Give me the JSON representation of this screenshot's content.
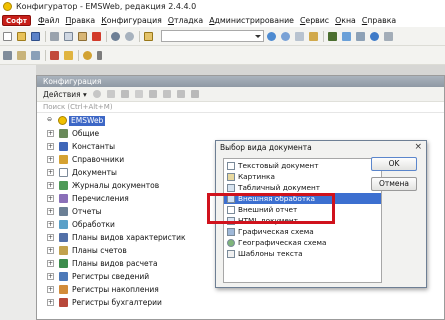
{
  "window": {
    "title": "Конфигуратор - EMSWeb, редакция 2.4.4.0"
  },
  "menubar": {
    "logo": "Софт",
    "items": [
      "Файл",
      "Правка",
      "Конфигурация",
      "Отладка",
      "Администрирование",
      "Сервис",
      "Окна",
      "Справка"
    ]
  },
  "config_window": {
    "title": "Конфигурация",
    "actions_label": "Действия ▾",
    "search_placeholder": "Поиск (Ctrl+Alt+M)",
    "root": "EMSWeb",
    "nodes": [
      {
        "label": "Общие",
        "icon": "common-icon"
      },
      {
        "label": "Константы",
        "icon": "constants-icon"
      },
      {
        "label": "Справочники",
        "icon": "catalogs-icon"
      },
      {
        "label": "Документы",
        "icon": "documents-icon"
      },
      {
        "label": "Журналы документов",
        "icon": "journals-icon"
      },
      {
        "label": "Перечисления",
        "icon": "enums-icon"
      },
      {
        "label": "Отчеты",
        "icon": "reports-icon"
      },
      {
        "label": "Обработки",
        "icon": "processing-icon"
      },
      {
        "label": "Планы видов характеристик",
        "icon": "chart-types-icon"
      },
      {
        "label": "Планы счетов",
        "icon": "chart-accounts-icon"
      },
      {
        "label": "Планы видов расчета",
        "icon": "calc-types-icon"
      },
      {
        "label": "Регистры сведений",
        "icon": "info-registers-icon"
      },
      {
        "label": "Регистры накопления",
        "icon": "accum-registers-icon"
      },
      {
        "label": "Регистры бухгалтерии",
        "icon": "account-registers-icon"
      }
    ]
  },
  "dialog": {
    "title": "Выбор вида документа",
    "close": "×",
    "ok": "OK",
    "cancel": "Отмена",
    "items": [
      "Текстовый документ",
      "Картинка",
      "Табличный документ",
      "Внешняя обработка",
      "Внешний отчет",
      "HTML документ",
      "Графическая схема",
      "Географическая схема",
      "Шаблоны текста"
    ],
    "selected_index": 3
  },
  "colors": {
    "selection": "#3c6fd0",
    "highlight_frame": "#d0121c",
    "logo": "#c8201a"
  }
}
